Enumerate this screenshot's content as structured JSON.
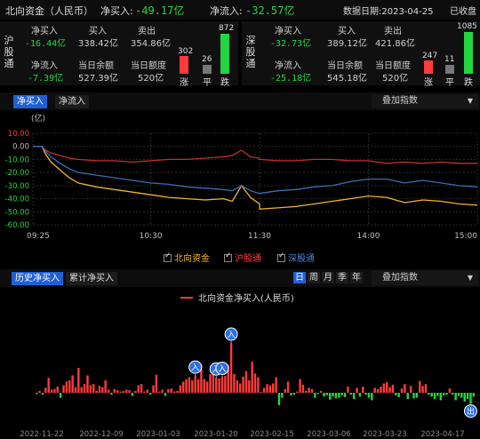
{
  "header": {
    "title": "北向资金（人民币）",
    "net_buy_label": "净买入:",
    "net_buy_value": "-49.17亿",
    "net_flow_label": "净流入:",
    "net_flow_value": "-32.57亿",
    "date_label": "数据日期:2023-04-25",
    "status": "已收盘"
  },
  "sh": {
    "name": "沪股通",
    "net_buy_label": "净买入",
    "net_buy_value": "-16.44亿",
    "buy_label": "买入",
    "buy_value": "338.42亿",
    "sell_label": "卖出",
    "sell_value": "354.86亿",
    "net_flow_label": "净流入",
    "net_flow_value": "-7.39亿",
    "balance_label": "当日余额",
    "balance_value": "527.39亿",
    "quota_label": "当日额度",
    "quota_value": "520亿",
    "up_count": "302",
    "flat_count": "26",
    "down_count": "872",
    "up_label": "涨",
    "flat_label": "平",
    "down_label": "跌"
  },
  "sz": {
    "name": "深股通",
    "net_buy_label": "净买入",
    "net_buy_value": "-32.73亿",
    "buy_label": "买入",
    "buy_value": "389.12亿",
    "sell_label": "卖出",
    "sell_value": "421.86亿",
    "net_flow_label": "净流入",
    "net_flow_value": "-25.18亿",
    "balance_label": "当日余额",
    "balance_value": "545.18亿",
    "quota_label": "当日额度",
    "quota_value": "520亿",
    "up_count": "247",
    "flat_count": "11",
    "down_count": "1085",
    "up_label": "涨",
    "flat_label": "平",
    "down_label": "跌"
  },
  "intraday": {
    "tab_net_buy": "净买入",
    "tab_net_flow": "净流入",
    "overlay_label": "叠加指数",
    "unit": "(亿)",
    "legend": [
      "北向资金",
      "沪股通",
      "深股通"
    ]
  },
  "history": {
    "tab_history": "历史净买入",
    "tab_cumulative": "累计净买入",
    "periods": [
      "日",
      "周",
      "月",
      "季",
      "年"
    ],
    "overlay_label": "叠加指数",
    "legend": "北向资金净买入(人民币)",
    "marker_in": "入",
    "marker_out": "出"
  },
  "colors": {
    "up": "#ff3a3a",
    "down": "#22d640",
    "north": "#f0b428",
    "sh": "#c03030",
    "sz": "#3c6cb4",
    "accent": "#1f5fd6"
  },
  "chart_data": [
    {
      "type": "line",
      "x_ticks": [
        "09:25",
        "10:30",
        "11:30",
        "14:00",
        "15:00"
      ],
      "y_ticks": [
        "10.00",
        "0.00",
        "-10.00",
        "-20.00",
        "-30.00",
        "-40.00",
        "-50.00",
        "-60.00"
      ],
      "ylim": [
        -60,
        10
      ],
      "ylabel": "(亿)",
      "x": [
        "09:25",
        "09:30",
        "09:32",
        "09:35",
        "09:40",
        "09:45",
        "09:50",
        "10:00",
        "10:10",
        "10:20",
        "10:30",
        "10:40",
        "10:50",
        "11:00",
        "11:10",
        "11:15",
        "11:20",
        "11:25",
        "11:30",
        "13:00",
        "13:10",
        "13:20",
        "13:30",
        "13:40",
        "13:50",
        "14:00",
        "14:10",
        "14:20",
        "14:30",
        "14:40",
        "14:50",
        "15:00"
      ],
      "series": [
        {
          "name": "北向资金",
          "values": [
            0,
            0,
            -6,
            -12,
            -18,
            -24,
            -28,
            -31,
            -33,
            -35,
            -37,
            -39,
            -40,
            -41,
            -40,
            -42,
            -30,
            -39,
            -44,
            -48,
            -47,
            -46,
            -44,
            -42,
            -40,
            -38,
            -39,
            -43,
            -41,
            -42,
            -44,
            -45
          ]
        },
        {
          "name": "沪股通",
          "values": [
            0,
            0,
            -3,
            -5,
            -7,
            -9,
            -10,
            -11,
            -11,
            -12,
            -11,
            -10,
            -10,
            -9,
            -8,
            -7,
            -3,
            -8,
            -9,
            -10,
            -11,
            -11,
            -10,
            -10,
            -11,
            -11,
            -13,
            -12,
            -13,
            -12,
            -13,
            -13
          ]
        },
        {
          "name": "深股通",
          "values": [
            0,
            0,
            -4,
            -8,
            -13,
            -17,
            -20,
            -22,
            -24,
            -26,
            -28,
            -29,
            -31,
            -32,
            -33,
            -34,
            -30,
            -34,
            -36,
            -36,
            -34,
            -33,
            -31,
            -30,
            -27,
            -25,
            -25,
            -28,
            -26,
            -28,
            -30,
            -31
          ]
        }
      ]
    },
    {
      "type": "bar",
      "title": "北向资金净买入(人民币)",
      "x_ticks": [
        "2022-11-22",
        "2022-12-09",
        "2023-01-03",
        "2023-01-20",
        "2023-02-15",
        "2023-03-06",
        "2023-03-23",
        "2023-04-17"
      ],
      "values": [
        -2,
        3,
        -3,
        8,
        24,
        5,
        6,
        10,
        -8,
        12,
        18,
        20,
        28,
        9,
        40,
        9,
        14,
        28,
        12,
        14,
        3,
        11,
        9,
        20,
        5,
        -3,
        6,
        4,
        2,
        3,
        5,
        4,
        -5,
        3,
        12,
        14,
        2,
        5,
        -3,
        12,
        29,
        2,
        5,
        -5,
        6,
        7,
        2,
        3,
        12,
        18,
        22,
        25,
        20,
        27,
        22,
        45,
        22,
        18,
        30,
        35,
        24,
        23,
        25,
        27,
        45,
        80,
        30,
        20,
        15,
        26,
        35,
        20,
        50,
        31,
        25,
        1,
        8,
        14,
        12,
        15,
        25,
        -20,
        -8,
        6,
        18,
        -4,
        -3,
        2,
        22,
        13,
        3,
        8,
        6,
        -8,
        -2,
        3,
        -6,
        -4,
        -11,
        -6,
        -9,
        -8,
        -4,
        -7,
        10,
        -3,
        -10,
        8,
        -6,
        10,
        -3,
        -8,
        -12,
        8,
        6,
        10,
        15,
        17,
        9,
        13,
        -4,
        -7,
        7,
        14,
        -10,
        11,
        -9,
        -8,
        19,
        11,
        14,
        -3,
        -6,
        -10,
        -5,
        -12,
        -4,
        -3,
        7,
        -3,
        -12,
        -5,
        -8,
        -14,
        -10,
        -18,
        -6
      ],
      "ylim": [
        -25,
        85
      ],
      "markers": [
        {
          "label": "入",
          "at": 53
        },
        {
          "label": "入",
          "at": 60
        },
        {
          "label": "入",
          "at": 62
        },
        {
          "label": "入",
          "at": 65
        },
        {
          "label": "出",
          "at": 145
        }
      ]
    }
  ]
}
